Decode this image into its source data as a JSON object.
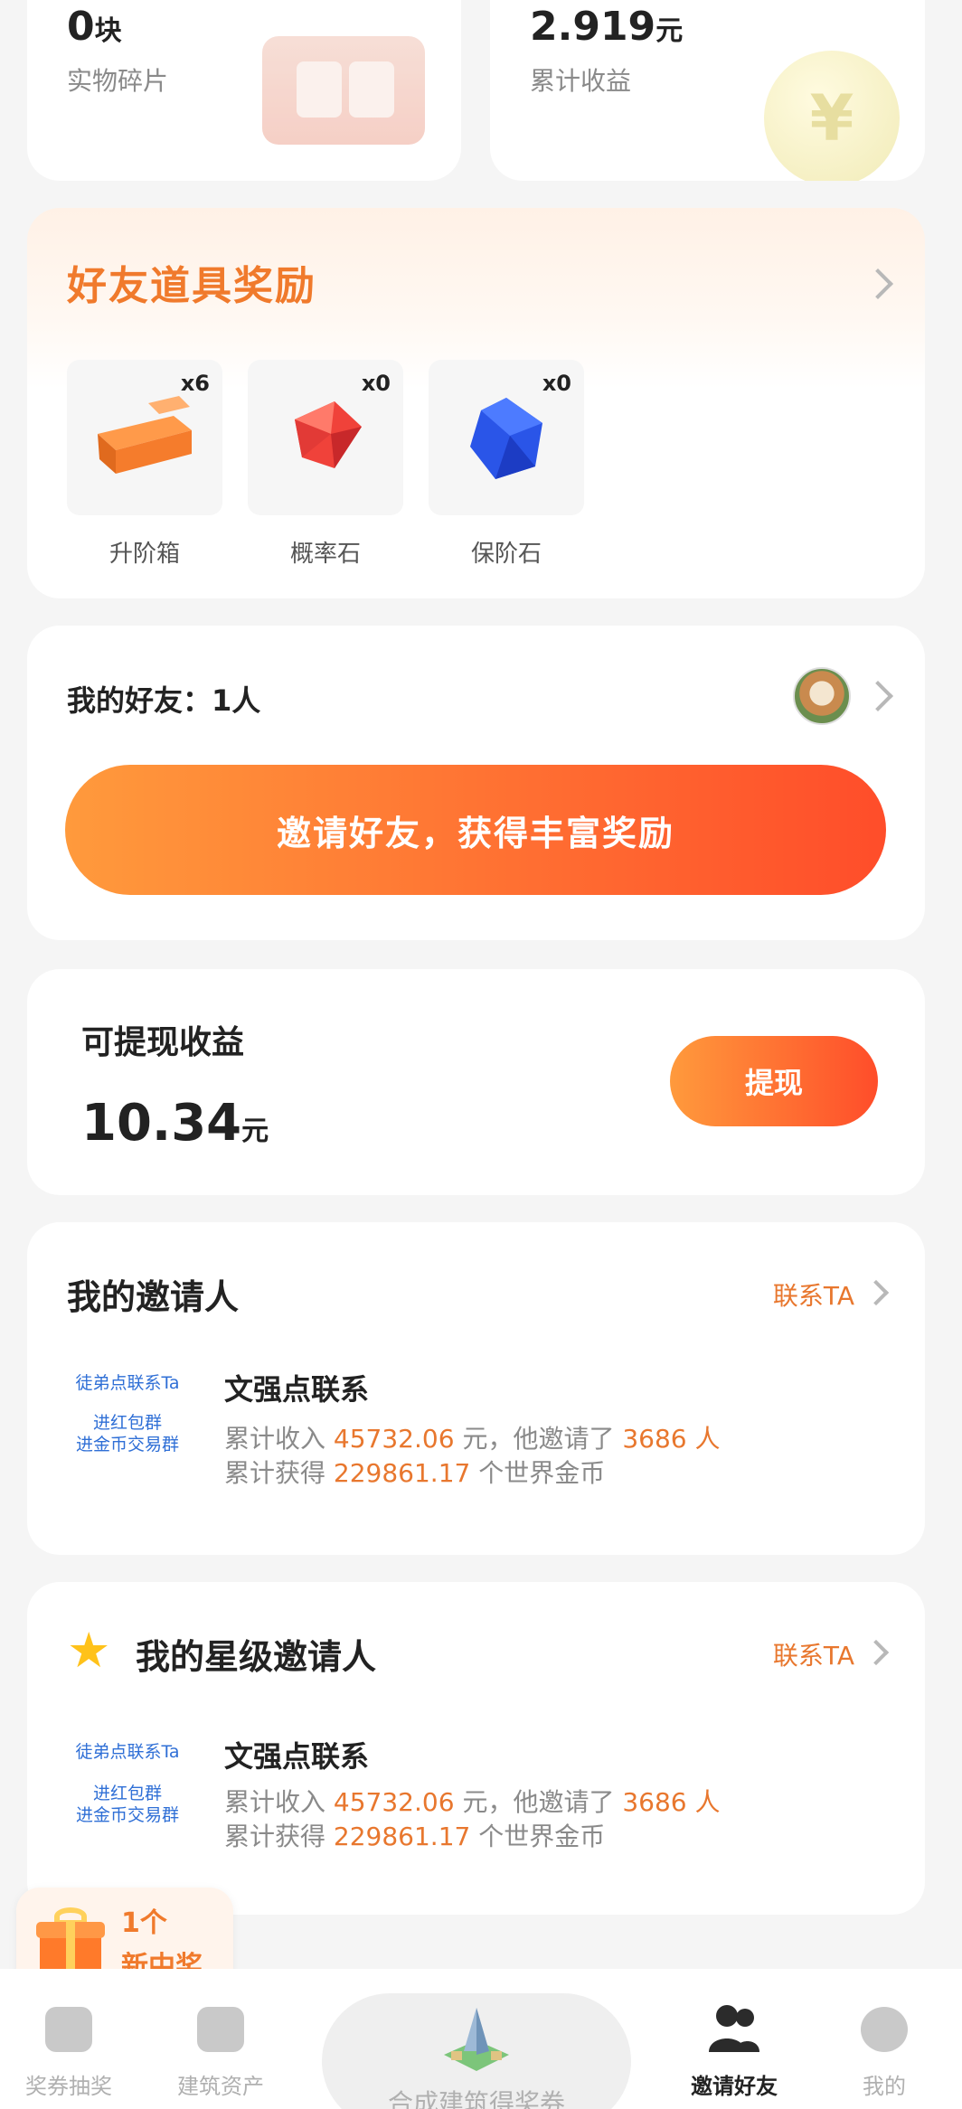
{
  "stats": [
    {
      "value": "0",
      "unit": "块",
      "label": "实物碎片"
    },
    {
      "value": "2.919",
      "unit": "元",
      "label": "累计收益"
    }
  ],
  "rewards": {
    "title": "好友道具奖励",
    "items": [
      {
        "label": "升阶箱",
        "count": "x6",
        "icon": "orange-box-icon"
      },
      {
        "label": "概率石",
        "count": "x0",
        "icon": "red-gem-icon"
      },
      {
        "label": "保阶石",
        "count": "x0",
        "icon": "blue-gem-icon"
      }
    ]
  },
  "friends": {
    "label": "我的好友：1人",
    "invite_button": "邀请好友，获得丰富奖励"
  },
  "withdraw": {
    "label": "可提现收益",
    "amount": "10.34",
    "unit": "元",
    "button": "提现"
  },
  "inviters": [
    {
      "title": "我的邀请人",
      "contact": "联系TA",
      "tag_line1": "徒弟点联系Ta",
      "tag_line2": "进红包群",
      "tag_line3": "进金币交易群",
      "name": "文强点联系",
      "income_prefix": "累计收入",
      "income": "45732.06",
      "income_mid": "元，他邀请了",
      "invited": "3686",
      "invited_suffix": "人",
      "coins_prefix": "累计获得",
      "coins": "229861.17",
      "coins_suffix": "个世界金币"
    },
    {
      "title": "我的星级邀请人",
      "contact": "联系TA",
      "tag_line1": "徒弟点联系Ta",
      "tag_line2": "进红包群",
      "tag_line3": "进金币交易群",
      "name": "文强点联系",
      "income_prefix": "累计收入",
      "income": "45732.06",
      "income_mid": "元，他邀请了",
      "invited": "3686",
      "invited_suffix": "人",
      "coins_prefix": "累计获得",
      "coins": "229861.17",
      "coins_suffix": "个世界金币"
    }
  ],
  "prize_badge": {
    "count": "1个",
    "text": "新中奖"
  },
  "nav": {
    "items": [
      {
        "label": "奖券抽奖",
        "icon": "lottery-icon"
      },
      {
        "label": "建筑资产",
        "icon": "building-asset-icon"
      },
      {
        "label": "邀请好友",
        "icon": "invite-friends-icon",
        "active": true
      },
      {
        "label": "我的",
        "icon": "profile-icon"
      }
    ],
    "center_label": "合成建筑得奖券"
  },
  "colors": {
    "accent": "#f07a2c",
    "button_gradient_start": "#ff9a3c",
    "button_gradient_end": "#ff4d2a",
    "link_blue": "#2f6fd6"
  }
}
